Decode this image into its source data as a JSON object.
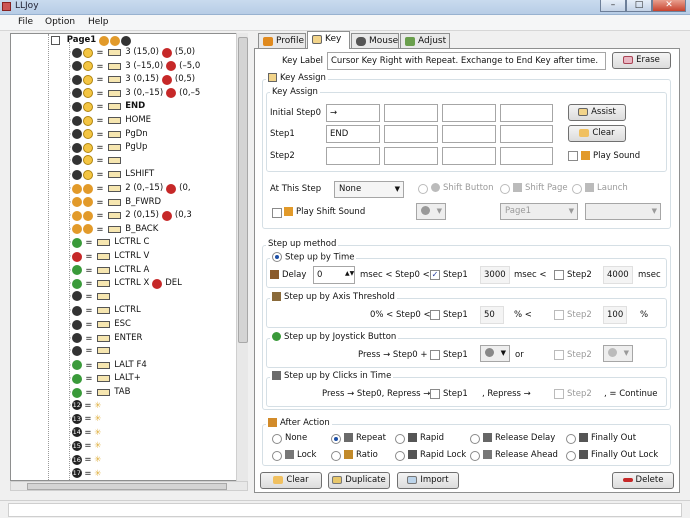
{
  "window": {
    "title": "LLJoy",
    "min_glyph": "–",
    "max_glyph": "□",
    "close_glyph": "✕"
  },
  "menu": [
    "File",
    "Option",
    "Help"
  ],
  "tree": {
    "root_label": "Page1",
    "rows": [
      {
        "text": "3 (15,0)",
        "extra": "(5,0)"
      },
      {
        "text": "3 (–15,0)",
        "extra": "(–5,0"
      },
      {
        "text": "3 (0,15)",
        "extra": "(0,5)"
      },
      {
        "text": "3 (0,–15)",
        "extra": "(0,–5"
      },
      {
        "text": "END",
        "extra": ""
      },
      {
        "text": "HOME",
        "extra": ""
      },
      {
        "text": "PgDn",
        "extra": ""
      },
      {
        "text": "PgUp",
        "extra": ""
      },
      {
        "text": "",
        "extra": ""
      },
      {
        "text": "LSHIFT",
        "extra": ""
      },
      {
        "text": "2 (0,–15)",
        "extra": "(0,"
      },
      {
        "text": "B_FWRD",
        "extra": ""
      },
      {
        "text": "2 (0,15)",
        "extra": "(0,3"
      },
      {
        "text": "B_BACK",
        "extra": ""
      },
      {
        "text": "LCTRL C",
        "extra": ""
      },
      {
        "text": "LCTRL V",
        "extra": ""
      },
      {
        "text": "LCTRL A",
        "extra": ""
      },
      {
        "text": "LCTRL X",
        "extra": "DEL"
      },
      {
        "text": "",
        "extra": ""
      },
      {
        "text": "LCTRL",
        "extra": ""
      },
      {
        "text": "ESC",
        "extra": ""
      },
      {
        "text": "ENTER",
        "extra": ""
      },
      {
        "text": "",
        "extra": ""
      },
      {
        "text": "LALT F4",
        "extra": ""
      },
      {
        "text": "LALT+",
        "extra": ""
      },
      {
        "text": "TAB",
        "extra": ""
      },
      {
        "text": "",
        "extra": ""
      },
      {
        "text": "",
        "extra": ""
      },
      {
        "text": "",
        "extra": ""
      },
      {
        "text": "",
        "extra": ""
      },
      {
        "text": "",
        "extra": ""
      },
      {
        "text": "",
        "extra": ""
      }
    ],
    "numbered": [
      "12",
      "13",
      "14",
      "15",
      "16",
      "17"
    ]
  },
  "tabs": [
    "Profile",
    "Key",
    "Mouse",
    "Adjust"
  ],
  "key": {
    "key_label_label": "Key Label",
    "key_label_value": "Cursor Key Right with Repeat. Exchange to End Key after time.",
    "erase": "Erase",
    "key_assign_group": "Key Assign",
    "key_assign_sub": "Key Assign",
    "initial_step0": "Initial Step0",
    "initial_step0_value": "→",
    "step1": "Step1",
    "step1_value": "END",
    "step2": "Step2",
    "assist": "Assist",
    "clear": "Clear",
    "play_sound": "Play Sound",
    "at_this_step": "At This Step",
    "at_this_step_value": "None",
    "shift_button": "Shift Button",
    "shift_page": "Shift Page",
    "launch": "Launch",
    "play_shift_sound": "Play Shift Sound",
    "page_select": "Page1"
  },
  "stepup": {
    "method_title": "Step up method",
    "by_time": "Step up by Time",
    "delay": "Delay",
    "delay_value": "0",
    "msec_lt_step0": "msec < Step0 <",
    "step1": "Step1",
    "step1_time": "3000",
    "msec_lt": "msec <",
    "step2": "Step2",
    "step2_time": "4000",
    "msec": "msec",
    "by_axis": "Step up by Axis Threshold",
    "axis_prefix": "0% < Step0 <",
    "axis_step1": "50",
    "pct_lt": "% <",
    "axis_step2": "100",
    "pct": "%",
    "by_joystick": "Step up by Joystick Button",
    "press_step0": "Press → Step0 +",
    "or": "or",
    "by_clicks": "Step up by Clicks in Time",
    "press_repress": "Press → Step0, Repress →",
    "repress": ", Repress →",
    "continue": ", = Continue"
  },
  "after": {
    "title": "After Action",
    "options": [
      "None",
      "Repeat",
      "Rapid",
      "Release Delay",
      "Finally Out",
      "Lock",
      "Ratio",
      "Rapid Lock",
      "Release Ahead",
      "Finally Out Lock"
    ],
    "selected": "Repeat"
  },
  "bottom": {
    "clear": "Clear",
    "duplicate": "Duplicate",
    "import": "Import",
    "delete": "Delete"
  },
  "colors": {
    "accent": "#1d4fa6",
    "delete_icon": "#c62828",
    "titlebar": "#c9dbee"
  }
}
